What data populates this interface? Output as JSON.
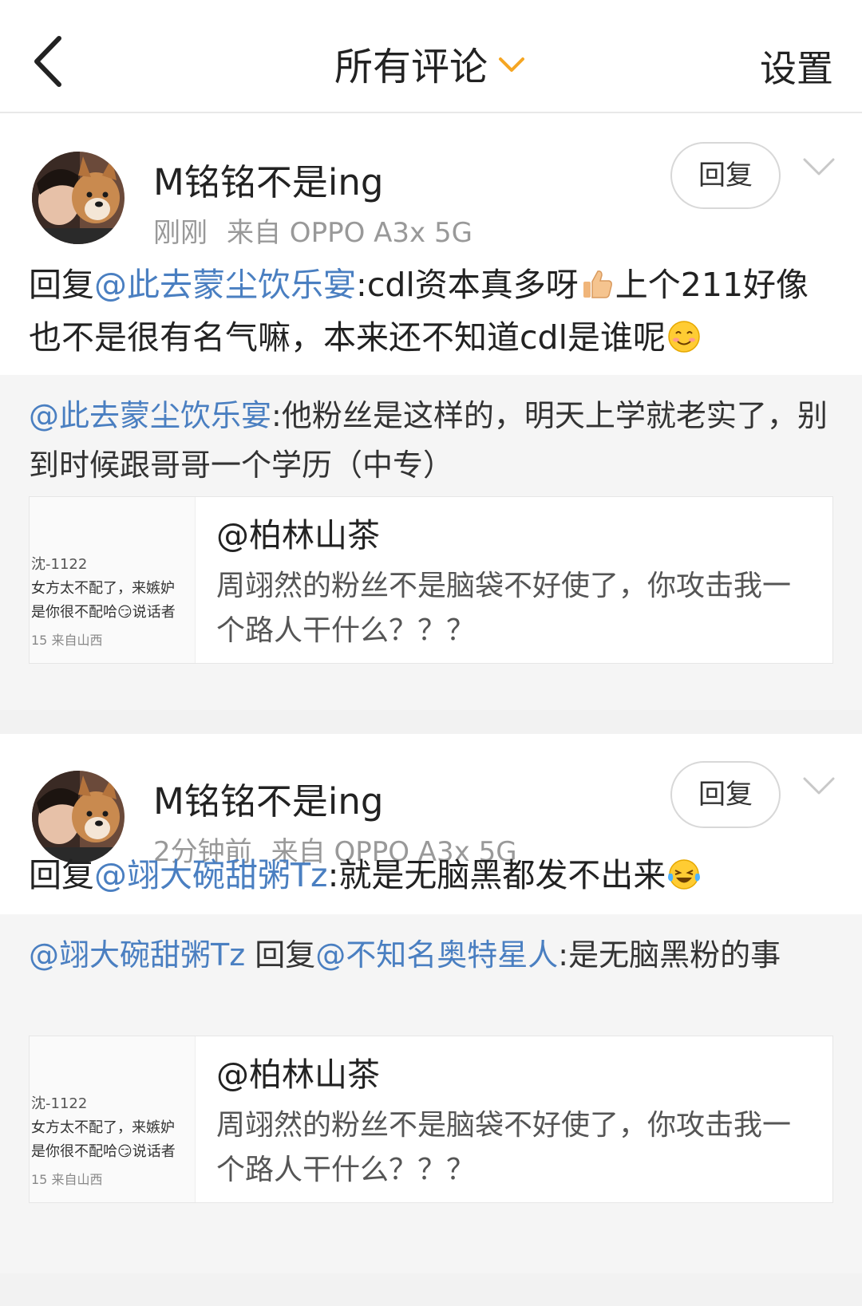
{
  "header": {
    "title": "所有评论",
    "settings_label": "设置"
  },
  "comments": [
    {
      "username": "M铭铭不是ing",
      "time": "刚刚",
      "source": "来自 OPPO A3x 5G",
      "reply_label": "回复",
      "prefix": "回复",
      "mention": "@此去蒙尘饮乐宴",
      "text_a": ":cdl资本真多呀",
      "emoji_a": "thumbs-up-emoji",
      "text_b": "上个211好像也不是很有名气嘛，本来还不知道cdl是谁呢",
      "emoji_b": "smile-emoji",
      "quote": {
        "mention": "@此去蒙尘饮乐宴",
        "text": ":他粉丝是这样的，明天上学就老实了，别到时候跟哥哥一个学历（中专）"
      },
      "embed": {
        "thumb_lines": [
          "沈-1122",
          "女方太不配了，来嫉妒",
          "是你很不配哈😏说话者",
          "15 来自山西"
        ],
        "user": "@柏林山茶",
        "text": "周翊然的粉丝不是脑袋不好使了，你攻击我一个路人干什么？？？"
      }
    },
    {
      "username": "M铭铭不是ing",
      "time": "2分钟前",
      "source": "来自 OPPO A3x 5G",
      "reply_label": "回复",
      "prefix": "回复",
      "mention": "@翊大碗甜粥Tz",
      "text_a": ":就是无脑黑都发不出来",
      "emoji_a": "laughing-tears-emoji",
      "quote": {
        "mention": "@翊大碗甜粥Tz",
        "mid": " 回复",
        "mention2": "@不知名奥特星人",
        "text": ":是无脑黑粉的事"
      },
      "embed": {
        "thumb_lines": [
          "沈-1122",
          "女方太不配了，来嫉妒",
          "是你很不配哈😏说话者",
          "15 来自山西"
        ],
        "user": "@柏林山茶",
        "text": "周翊然的粉丝不是脑袋不好使了，你攻击我一个路人干什么？？？"
      }
    }
  ],
  "colors": {
    "mention": "#4a7fc1",
    "accent_chevron": "#f5a623",
    "meta": "#999999"
  }
}
